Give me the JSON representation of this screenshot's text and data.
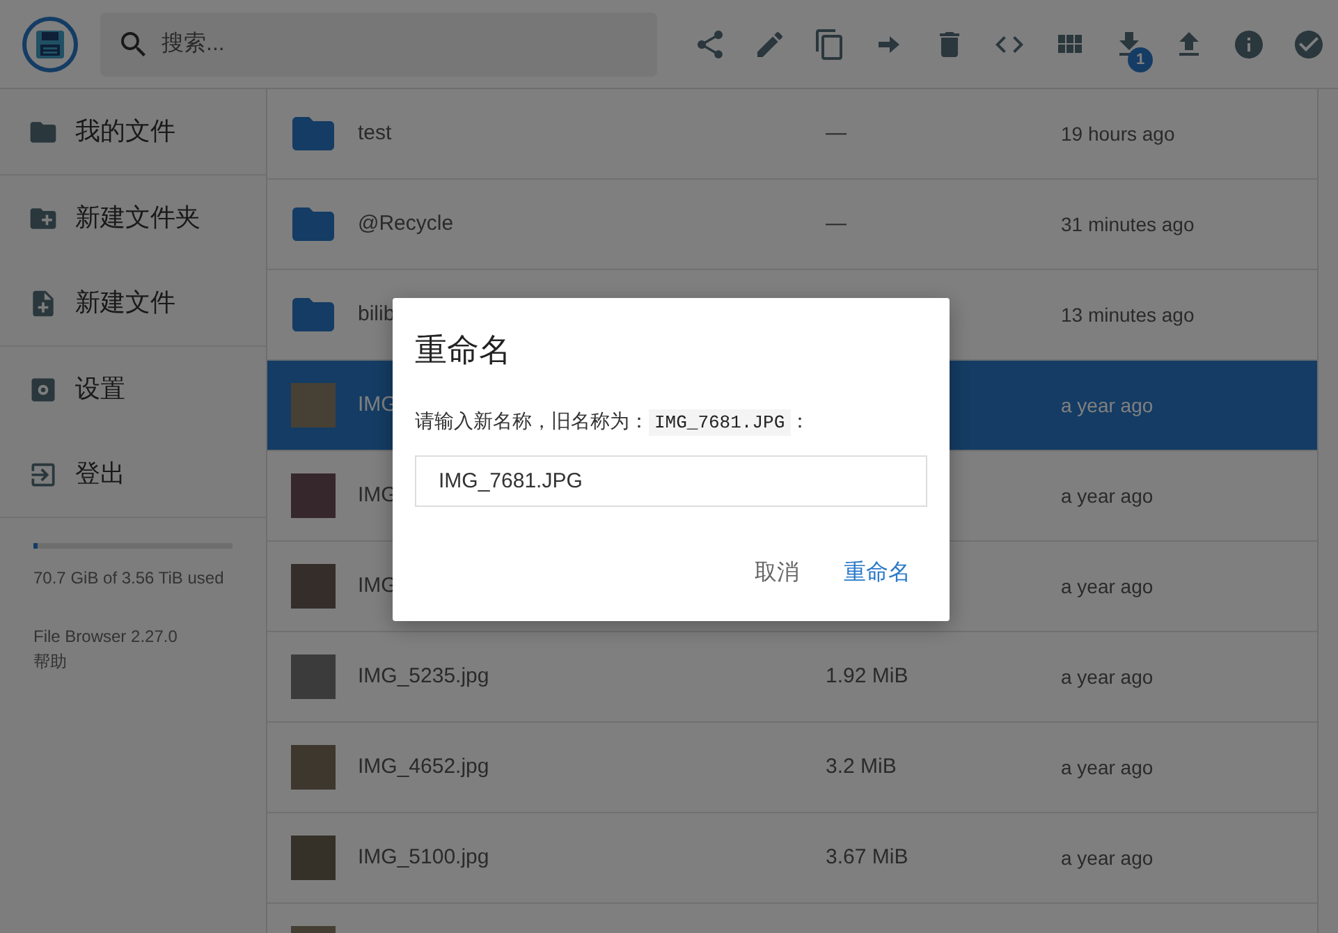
{
  "header": {
    "search": {
      "placeholder": "搜索..."
    },
    "download_badge": "1"
  },
  "sidebar": {
    "items": [
      {
        "label": "我的文件"
      },
      {
        "label": "新建文件夹"
      },
      {
        "label": "新建文件"
      },
      {
        "label": "设置"
      },
      {
        "label": "登出"
      }
    ],
    "storage": {
      "level": 0.02,
      "text": "70.7 GiB of 3.56 TiB used"
    },
    "version": "File Browser 2.27.0",
    "help_link": "帮助"
  },
  "files": [
    {
      "kind": "folder",
      "name": "test",
      "size": "—",
      "modified": "19 hours ago",
      "selected": false
    },
    {
      "kind": "folder",
      "name": "@Recycle",
      "size": "—",
      "modified": "31 minutes ago",
      "selected": false
    },
    {
      "kind": "folder",
      "name": "bilib",
      "modified": "13 minutes ago",
      "selected": false
    },
    {
      "kind": "image",
      "name": "IMG",
      "modified": "a year ago",
      "selected": true
    },
    {
      "kind": "image",
      "name": "IMG",
      "modified": "a year ago",
      "selected": false
    },
    {
      "kind": "image",
      "name": "IMG",
      "modified": "a year ago",
      "selected": false
    },
    {
      "kind": "image",
      "name": "IMG_5235.jpg",
      "size": "1.92 MiB",
      "modified": "a year ago",
      "selected": false
    },
    {
      "kind": "image",
      "name": "IMG_4652.jpg",
      "size": "3.2 MiB",
      "modified": "a year ago",
      "selected": false
    },
    {
      "kind": "image",
      "name": "IMG_5100.jpg",
      "size": "3.67 MiB",
      "modified": "a year ago",
      "selected": false
    },
    {
      "kind": "image",
      "selected": false
    }
  ],
  "dialog": {
    "title": "重命名",
    "message_prefix": "请输入新名称，旧名称为：",
    "old_name": "IMG_7681.JPG",
    "message_suffix": "：",
    "value": "IMG_7681.JPG",
    "buttons": [
      {
        "label": "取消",
        "kind": "secondary"
      },
      {
        "label": "重命名",
        "kind": "primary"
      }
    ]
  }
}
